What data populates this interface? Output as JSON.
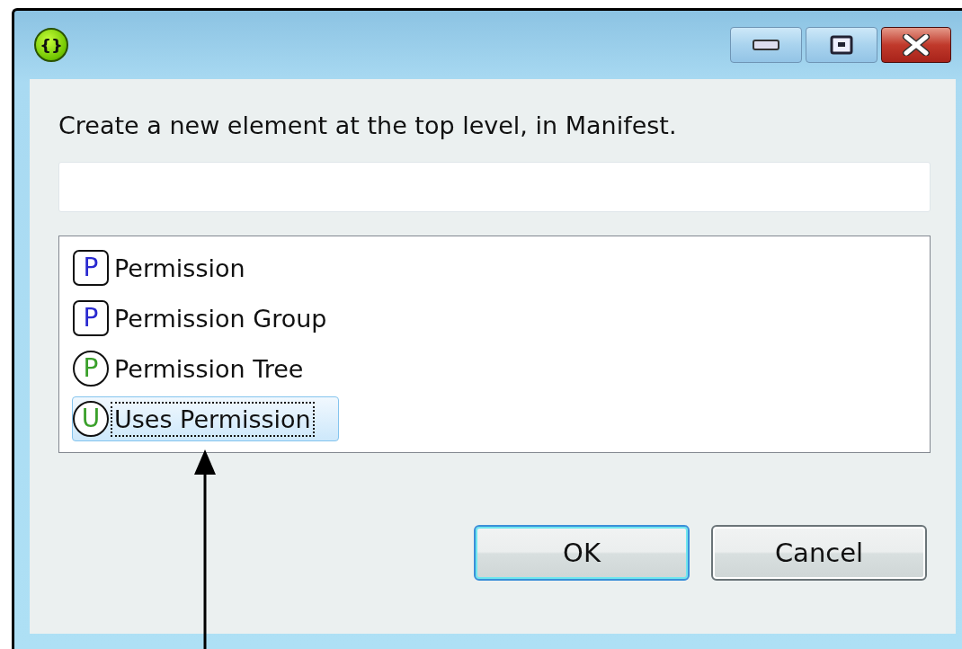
{
  "window": {
    "title_icon": "{}"
  },
  "dialog": {
    "prompt": "Create a new element at the top level, in Manifest.",
    "items": [
      {
        "label": "Permission",
        "icon_letter": "P",
        "kind": "square",
        "selected": false
      },
      {
        "label": "Permission Group",
        "icon_letter": "P",
        "kind": "square",
        "selected": false
      },
      {
        "label": "Permission Tree",
        "icon_letter": "P",
        "kind": "circle",
        "selected": false
      },
      {
        "label": "Uses Permission",
        "icon_letter": "U",
        "kind": "circle",
        "selected": true
      }
    ],
    "buttons": [
      {
        "label": "OK",
        "default": true
      },
      {
        "label": "Cancel",
        "default": false
      }
    ]
  }
}
